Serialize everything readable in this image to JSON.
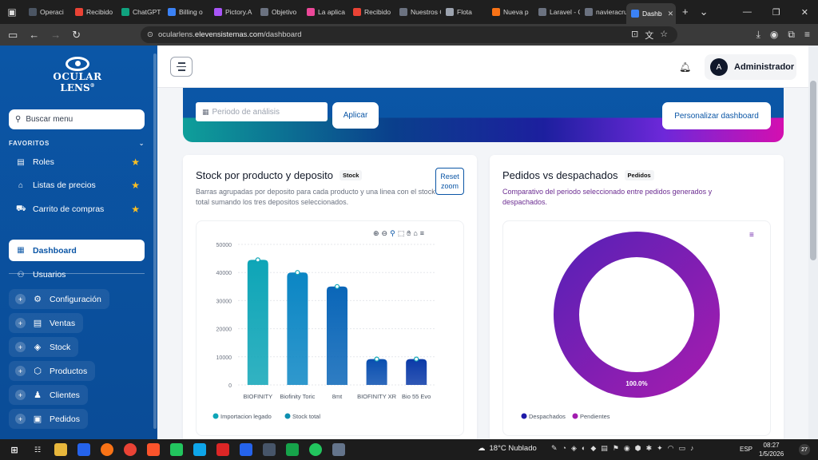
{
  "browser": {
    "tabs": [
      {
        "label": "Operaci",
        "color": "#4b5563"
      },
      {
        "label": "Recibido",
        "color": "#ea4335"
      },
      {
        "label": "ChatGPT",
        "color": "#10a37f"
      },
      {
        "label": "Billing o",
        "color": "#3b82f6"
      },
      {
        "label": "Pictory.A",
        "color": "#a855f7"
      },
      {
        "label": "Objetivo",
        "color": "#6b7280"
      },
      {
        "label": "La aplica",
        "color": "#ec4899"
      },
      {
        "label": "Recibido",
        "color": "#ea4335"
      },
      {
        "label": "Nuestros Cli",
        "color": "#6b7280"
      },
      {
        "label": "Flota",
        "color": "#9ca3af"
      },
      {
        "label": "Nueva p",
        "color": "#f97316"
      },
      {
        "label": "Laravel - Cer",
        "color": "#6b7280"
      },
      {
        "label": "navieracruzd",
        "color": "#6b7280"
      },
      {
        "label": "Dashb",
        "color": "#3b82f6",
        "active": true
      }
    ],
    "url_prefix": "ocularlens.",
    "url_domain": "elevensistemas.com",
    "url_path": "/dashboard"
  },
  "sidebar": {
    "logo_line1": "OCULAR",
    "logo_line2": "LENS",
    "logo_mark": "®",
    "search_placeholder": "Buscar menu",
    "favorites_heading": "FAVORITOS",
    "favorites": [
      {
        "label": "Roles",
        "icon": "id-card-icon"
      },
      {
        "label": "Listas de precios",
        "icon": "tag-icon"
      },
      {
        "label": "Carrito de compras",
        "icon": "cart-icon"
      }
    ],
    "items": [
      {
        "label": "Dashboard",
        "icon": "grid-icon",
        "active": true
      },
      {
        "label": "Usuarios",
        "icon": "users-icon"
      }
    ],
    "groups": [
      {
        "label": "Configuración",
        "icon": "gear-icon"
      },
      {
        "label": "Ventas",
        "icon": "receipt-icon"
      },
      {
        "label": "Stock",
        "icon": "layers-icon"
      },
      {
        "label": "Productos",
        "icon": "box-icon"
      },
      {
        "label": "Clientes",
        "icon": "people-icon"
      },
      {
        "label": "Pedidos",
        "icon": "clipboard-icon"
      }
    ]
  },
  "header": {
    "avatar_letter": "A",
    "user_name": "Administrador"
  },
  "filters": {
    "period_placeholder": "Periodo de análisis",
    "apply_label": "Aplicar",
    "customize_label": "Personalizar dashboard"
  },
  "stock_card": {
    "title": "Stock por producto y deposito",
    "tag": "Stock",
    "subtitle": "Barras agrupadas por deposito para cada producto y una linea con el stock total sumando los tres depositos seleccionados.",
    "reset_zoom": "Reset zoom"
  },
  "orders_card": {
    "title": "Pedidos vs despachados",
    "tag": "Pedidos",
    "subtitle": "Comparativo del periodo seleccionado entre pedidos generados y despachados."
  },
  "chart_data": [
    {
      "type": "bar",
      "categories": [
        "BIOFINITY",
        "Biofinity Toric",
        "8mt",
        "BIOFINITY XR",
        "Bio 55 Evo"
      ],
      "tick_labels": [
        "0",
        "10000",
        "20000",
        "30000",
        "40000",
        "50000"
      ],
      "ylim": [
        0,
        50000
      ],
      "grid": true,
      "legend_position": "bottom",
      "series": [
        {
          "name": "Importacion legado",
          "type": "bar",
          "values": [
            44500,
            40000,
            35000,
            9200,
            9200
          ],
          "colors": [
            "#0ea5b7",
            "#0b86c4",
            "#0a66b8",
            "#0a4fb0",
            "#0b3aa8"
          ]
        },
        {
          "name": "Stock total",
          "type": "line",
          "values": [
            44500,
            40000,
            35000,
            9200,
            9200
          ],
          "color": "#0ea5b7"
        }
      ]
    },
    {
      "type": "pie",
      "donut": true,
      "legend_position": "bottom",
      "series": [
        {
          "name": "Despachados",
          "value": 0,
          "color": "#1e1aa8"
        },
        {
          "name": "Pendientes",
          "value": 100,
          "color": "#a21caf"
        }
      ],
      "data_label": "100.0%"
    }
  ],
  "taskbar": {
    "weather": "18°C  Nublado",
    "lang": "ESP",
    "time": "08:27",
    "date": "1/5/2026",
    "notifications": "27"
  }
}
